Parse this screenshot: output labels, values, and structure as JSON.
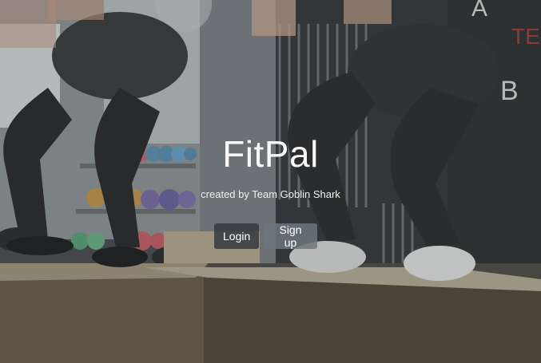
{
  "hero": {
    "title": "FitPal",
    "subtitle": "created by Team Goblin Shark"
  },
  "buttons": {
    "login": "Login",
    "signup": "Sign up"
  },
  "background": {
    "wall_letters": [
      "A",
      "TE",
      "B"
    ]
  }
}
